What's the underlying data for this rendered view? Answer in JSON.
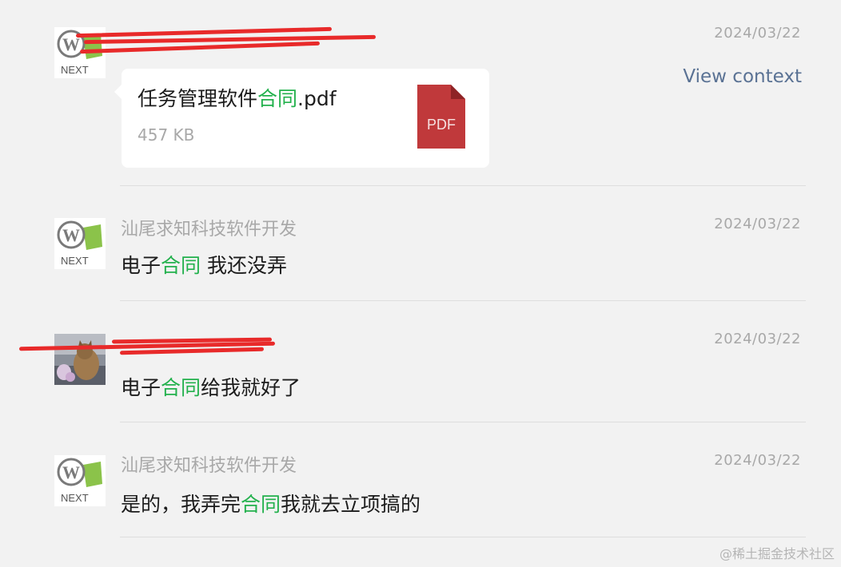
{
  "messages": [
    {
      "sender": "",
      "date": "2024/03/22",
      "file": {
        "name_before": "任务管理软件",
        "name_highlight": "合同",
        "name_after": ".pdf",
        "size": "457 KB",
        "icon_label": "PDF"
      },
      "action": "View context"
    },
    {
      "sender": "汕尾求知科技软件开发",
      "date": "2024/03/22",
      "text_before": "电子",
      "text_highlight": "合同",
      "text_after": " 我还没弄"
    },
    {
      "sender": "",
      "date": "2024/03/22",
      "text_before": "电子",
      "text_highlight": "合同",
      "text_after": "给我就好了"
    },
    {
      "sender": "汕尾求知科技软件开发",
      "date": "2024/03/22",
      "text_before": "是的，我弄完",
      "text_highlight": "合同",
      "text_after": "我就去立项搞的"
    }
  ],
  "avatar_logo_text": "NEXT",
  "watermark": "@稀土掘金技术社区",
  "colors": {
    "highlight": "#23b14d",
    "link": "#5a7294",
    "pdf_red": "#c0393b",
    "redaction": "#e82a2a",
    "background": "#f2f2f2"
  }
}
